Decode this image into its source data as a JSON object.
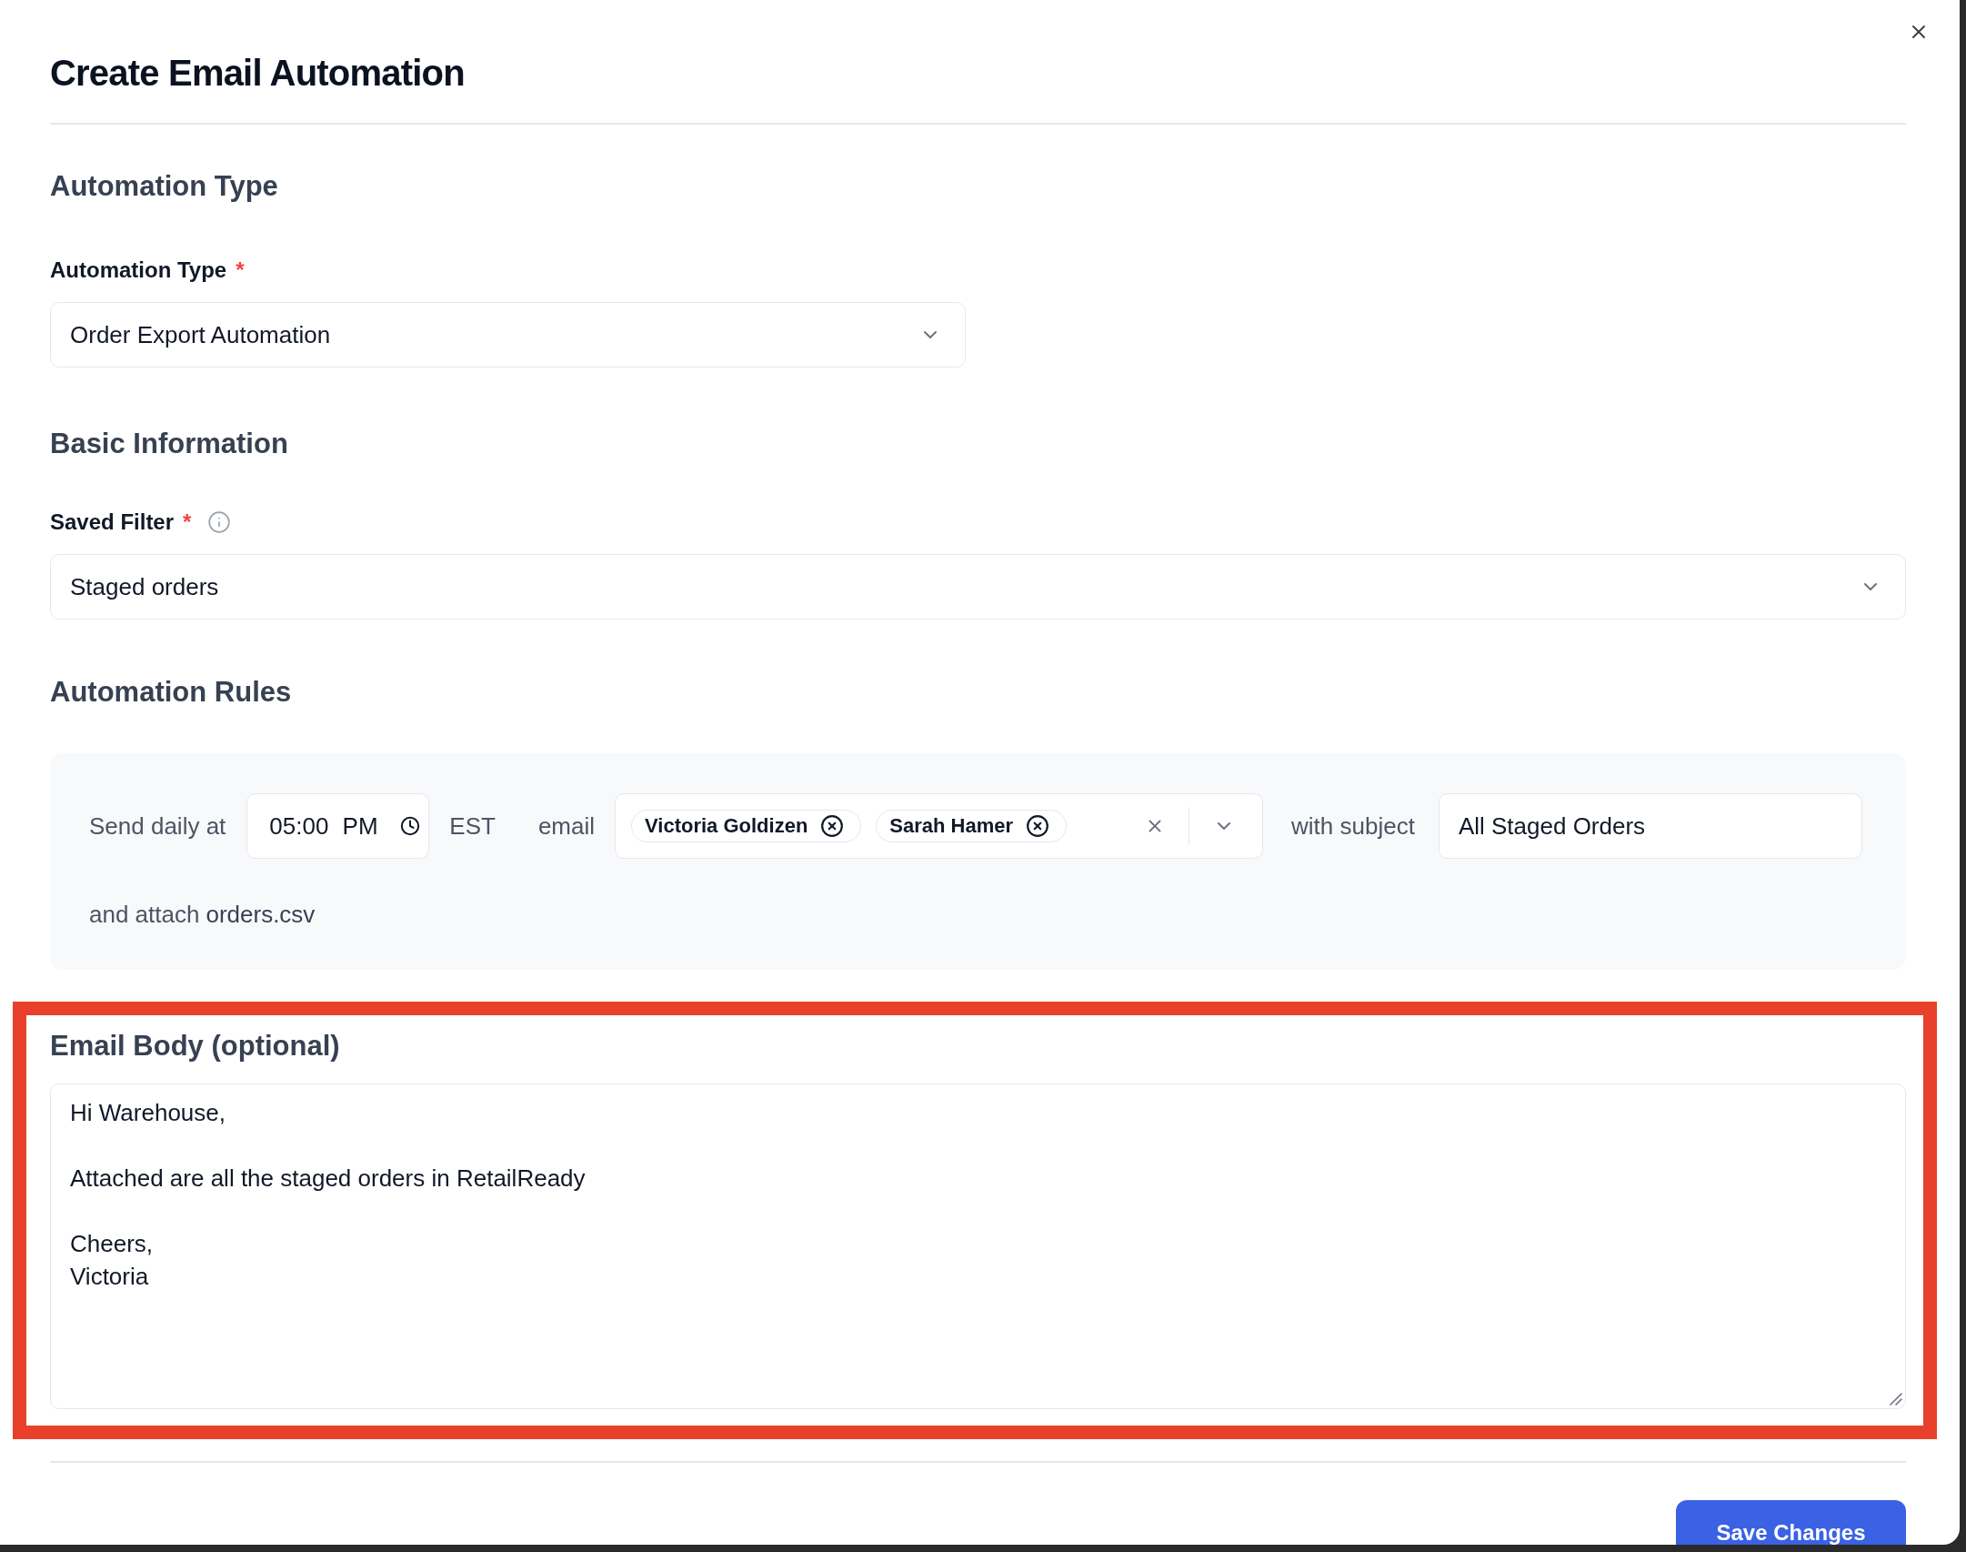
{
  "dialog": {
    "title": "Create Email Automation"
  },
  "automation_type": {
    "heading": "Automation Type",
    "field": {
      "label": "Automation Type",
      "required_mark": "*",
      "value": "Order Export Automation"
    }
  },
  "basic_information": {
    "heading": "Basic Information",
    "field": {
      "label": "Saved Filter",
      "required_mark": "*",
      "info_icon": true,
      "value": "Staged orders"
    }
  },
  "automation_rules": {
    "heading": "Automation Rules",
    "send_label": "Send daily at",
    "time": "05:00 PM",
    "timezone": "EST",
    "email_label": "email",
    "recipients": [
      {
        "name": "Victoria Goldizen"
      },
      {
        "name": "Sarah Hamer"
      }
    ],
    "subject_label": "with subject",
    "subject": "All Staged Orders",
    "attach_label": "and attach",
    "attachment": "orders.csv"
  },
  "email_body": {
    "heading": "Email Body (optional)",
    "highlighted": true,
    "value": "Hi Warehouse,\n\nAttached are all the staged orders in RetailReady\n\nCheers,\nVictoria"
  },
  "footer": {
    "save_button": "Save Changes"
  }
}
